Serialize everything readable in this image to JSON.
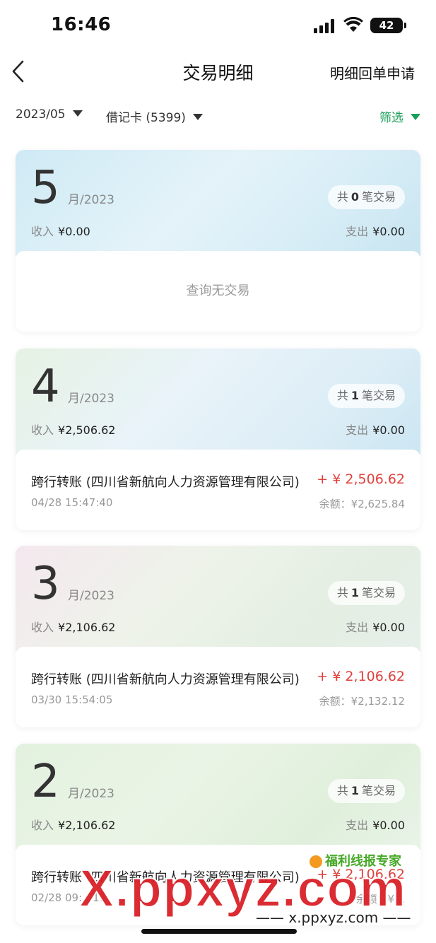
{
  "status_bar": {
    "time": "16:46",
    "battery": "42"
  },
  "nav": {
    "title": "交易明细",
    "right_action": "明细回单申请"
  },
  "filters": {
    "month": "2023/05",
    "card": "借记卡 (5399)",
    "screen": "筛选"
  },
  "labels": {
    "income": "收入",
    "expense": "支出",
    "month_suffix": "月/2023",
    "count_prefix": "共",
    "count_suffix": "笔交易",
    "empty": "查询无交易"
  },
  "months": [
    {
      "month": "5",
      "count": "0",
      "income": "¥0.00",
      "expense": "¥0.00",
      "transactions": []
    },
    {
      "month": "4",
      "count": "1",
      "income": "¥2,506.62",
      "expense": "¥0.00",
      "transactions": [
        {
          "title": "跨行转账 (四川省新航向人力资源管理有限公司)",
          "amount": "+ ¥ 2,506.62",
          "time": "04/28  15:47:40",
          "balance": "余额：¥2,625.84"
        }
      ]
    },
    {
      "month": "3",
      "count": "1",
      "income": "¥2,106.62",
      "expense": "¥0.00",
      "transactions": [
        {
          "title": "跨行转账 (四川省新航向人力资源管理有限公司)",
          "amount": "+ ¥ 2,106.62",
          "time": "03/30  15:54:05",
          "balance": "余额：¥2,132.12"
        }
      ]
    },
    {
      "month": "2",
      "count": "1",
      "income": "¥2,106.62",
      "expense": "¥0.00",
      "transactions": [
        {
          "title": "跨行转账 (四川省新航向人力资源管理有限公司)",
          "amount": "+ ¥ 2,106.62",
          "time": "02/28  09:…11",
          "balance": "余额：¥…"
        }
      ]
    }
  ],
  "watermark": {
    "brand": "福利线报专家",
    "big": "X.ppxyz.com",
    "small": "—— x.ppxyz.com ——"
  }
}
